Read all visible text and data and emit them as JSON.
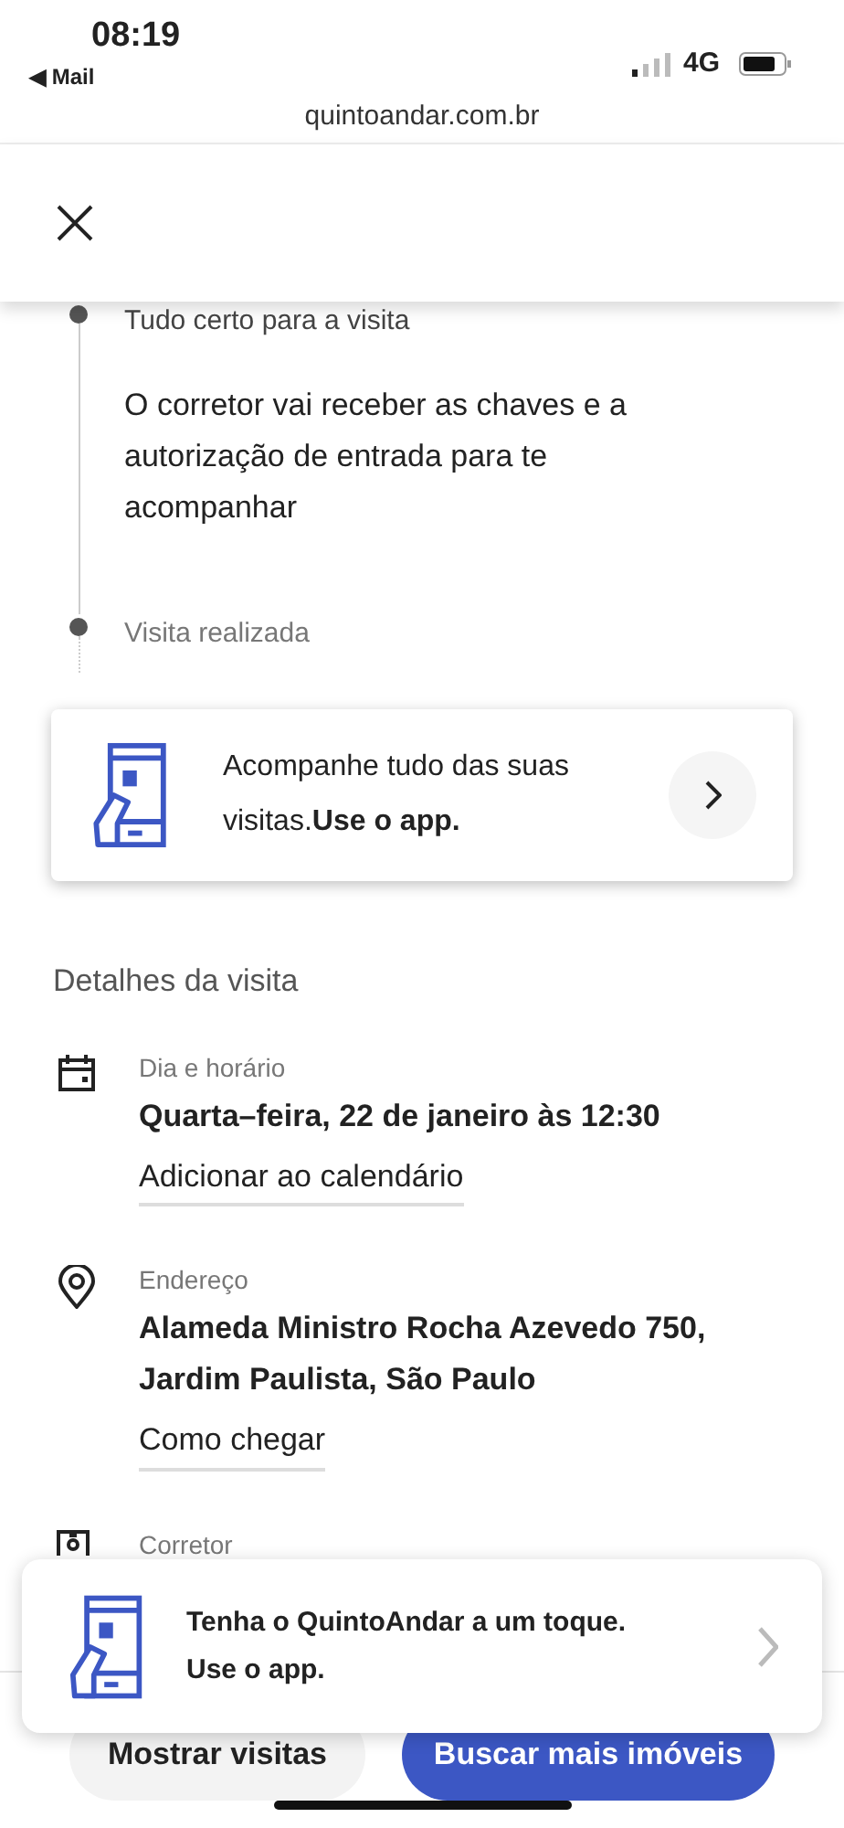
{
  "status_bar": {
    "time": "08:19",
    "back_app": "◀ Mail",
    "network": "4G"
  },
  "url_bar": {
    "url": "quintoandar.com.br"
  },
  "timeline": [
    {
      "title": "Tudo certo para a visita",
      "description": "O corretor vai receber as chaves e a autorização de entrada para te acompanhar"
    },
    {
      "title": "Visita realizada"
    }
  ],
  "app_card": {
    "text": "Acompanhe tudo das suas visitas.**Use o app.**"
  },
  "details": {
    "heading": "Detalhes da visita",
    "items": [
      {
        "kind": "calendar",
        "label": "Dia e horário",
        "value": "Quarta–feira, 22 de janeiro às 12:30",
        "link": "Adicionar ao calendário"
      },
      {
        "kind": "location",
        "label": "Endereço",
        "value": "Alameda Ministro Rocha Azevedo 750, Jardim Paulista, São Paulo",
        "link": "Como chegar"
      },
      {
        "kind": "broker",
        "label": "Corretor"
      }
    ]
  },
  "banner": {
    "title": "Tenha o QuintoAndar a um toque.",
    "subtitle": "Use o app."
  },
  "buttons": [
    {
      "kind": "secondary",
      "label": "Mostrar visitas"
    },
    {
      "kind": "primary",
      "label": "Buscar mais imóveis"
    }
  ]
}
